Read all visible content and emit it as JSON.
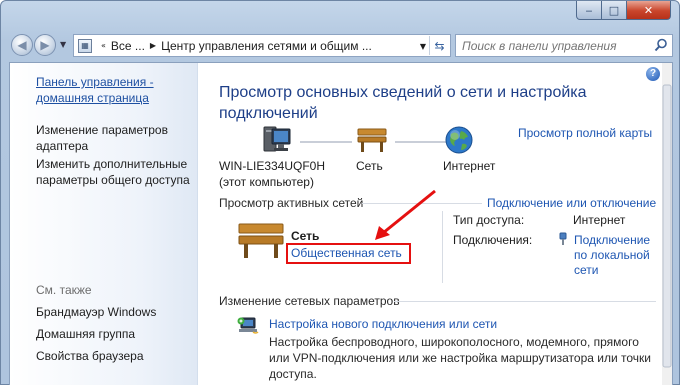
{
  "window": {
    "minimize_glyph": "‒",
    "maximize_glyph": "□",
    "close_glyph": "✕"
  },
  "nav": {
    "back_glyph": "◀",
    "forward_glyph": "▶",
    "breadcrumb": [
      "Все ...",
      "Центр управления сетями и общим ..."
    ],
    "search_placeholder": "Поиск в панели управления"
  },
  "sidebar": {
    "home_link": "Панель управления - домашняя страница",
    "home_line1": "Панель управления -",
    "home_line2": "домашняя страница",
    "tasks": [
      {
        "line1": "Изменение параметров",
        "line2": "адаптера"
      },
      {
        "line1": "Изменить дополнительные",
        "line2": "параметры общего доступа"
      }
    ],
    "see_also_label": "См. также",
    "see_also": [
      "Брандмауэр Windows",
      "Домашняя группа",
      "Свойства браузера"
    ]
  },
  "main": {
    "help_glyph": "?",
    "title_line1": "Просмотр основных сведений о сети и настройка",
    "title_line2": "подключений",
    "full_map_link": "Просмотр полной карты",
    "map": {
      "computer_name": "WIN-LIE334UQF0H",
      "computer_note": "(этот компьютер)",
      "network_label": "Сеть",
      "internet_label": "Интернет"
    },
    "active_networks": {
      "heading": "Просмотр активных сетей",
      "connect_link": "Подключение или отключение",
      "network_name": "Сеть",
      "network_type_link": "Общественная сеть",
      "access_type_label": "Тип доступа:",
      "access_type_value": "Интернет",
      "connections_label": "Подключения:",
      "connection_line1": "Подключение",
      "connection_line2": "по локальной",
      "connection_line3": "сети"
    },
    "change_settings": {
      "heading": "Изменение сетевых параметров",
      "new_connection_link": "Настройка нового подключения или сети",
      "desc_line1": "Настройка беспроводного, широкополосного, модемного, прямого",
      "desc_line2": "или VPN-подключения или же настройка маршрутизатора или точки",
      "desc_line3": "доступа."
    }
  },
  "colors": {
    "link": "#1e56b2",
    "title": "#1e3f88",
    "highlight": "#e51010",
    "close_button": "#c9452b"
  }
}
